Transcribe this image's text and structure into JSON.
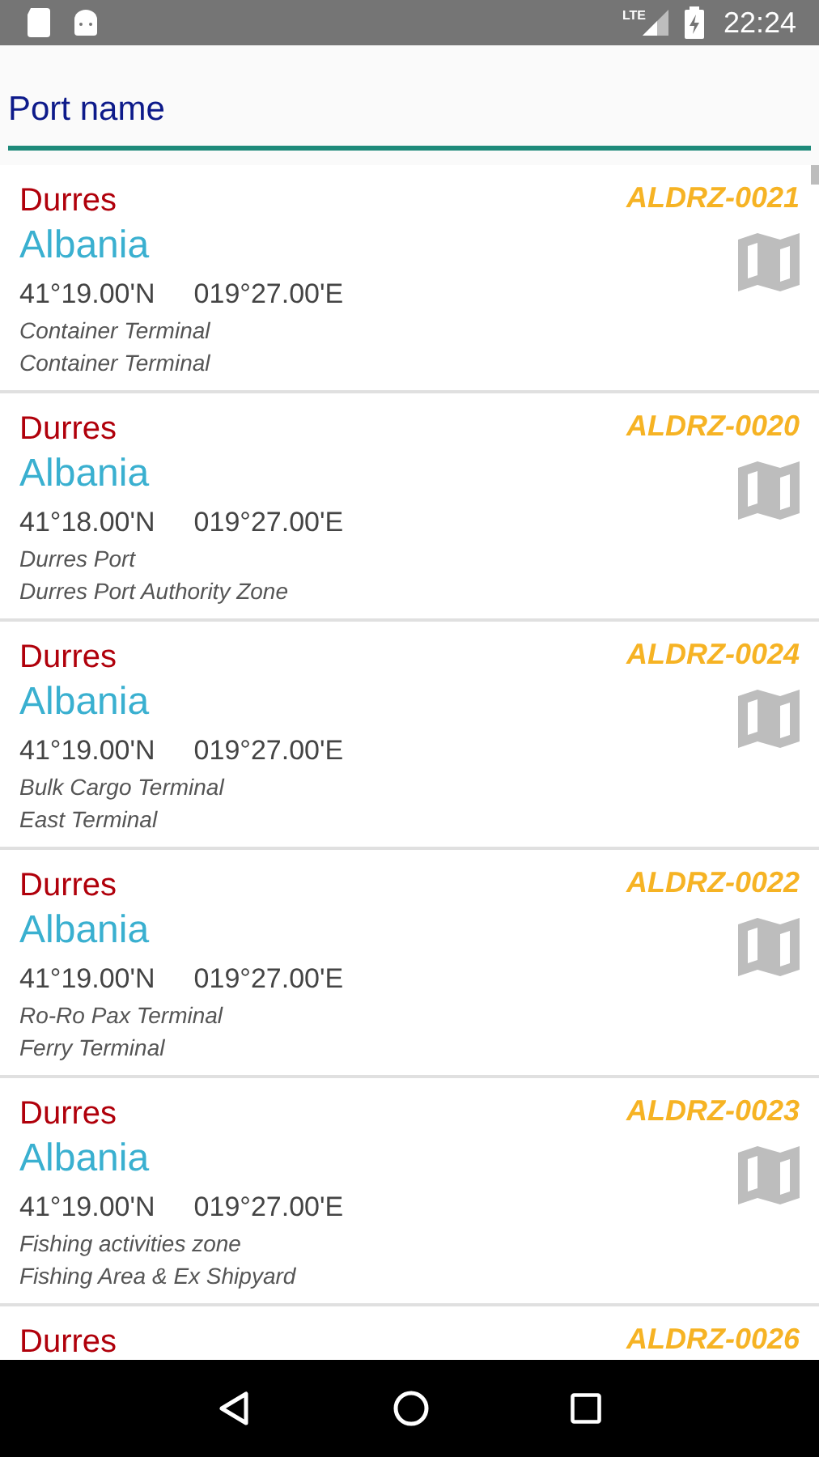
{
  "status_bar": {
    "time": "22:24",
    "network": "LTE"
  },
  "search": {
    "placeholder": "Port name"
  },
  "ports": [
    {
      "name": "Durres",
      "country": "Albania",
      "code": "ALDRZ-0021",
      "lat": "41°19.00'N",
      "lon": "019°27.00'E",
      "line1": "Container Terminal",
      "line2": "Container Terminal"
    },
    {
      "name": "Durres",
      "country": "Albania",
      "code": "ALDRZ-0020",
      "lat": "41°18.00'N",
      "lon": "019°27.00'E",
      "line1": "Durres Port",
      "line2": "Durres Port Authority Zone"
    },
    {
      "name": "Durres",
      "country": "Albania",
      "code": "ALDRZ-0024",
      "lat": "41°19.00'N",
      "lon": "019°27.00'E",
      "line1": "Bulk Cargo Terminal",
      "line2": "East Terminal"
    },
    {
      "name": "Durres",
      "country": "Albania",
      "code": "ALDRZ-0022",
      "lat": "41°19.00'N",
      "lon": "019°27.00'E",
      "line1": "Ro-Ro Pax Terminal",
      "line2": "Ferry Terminal"
    },
    {
      "name": "Durres",
      "country": "Albania",
      "code": "ALDRZ-0023",
      "lat": "41°19.00'N",
      "lon": "019°27.00'E",
      "line1": "Fishing activities zone",
      "line2": "Fishing Area & Ex Shipyard"
    },
    {
      "name": "Durres",
      "code": "ALDRZ-0026"
    }
  ]
}
